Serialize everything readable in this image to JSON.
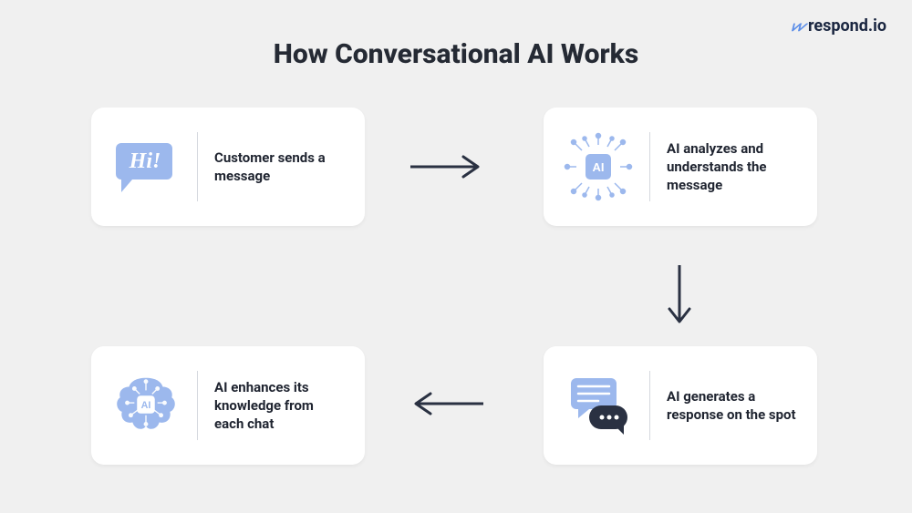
{
  "brand": {
    "name": "respond.io",
    "icon_label": "checkmark-wave"
  },
  "title": "How Conversational AI Works",
  "cards": {
    "step1": {
      "label": "Customer sends a message",
      "icon_name": "hi-speech-bubble-icon"
    },
    "step2": {
      "label": "AI analyzes and understands the message",
      "icon_name": "ai-chip-network-icon"
    },
    "step3": {
      "label": "AI generates a response on the spot",
      "icon_name": "chat-bubbles-icon"
    },
    "step4": {
      "label": "AI enhances its knowledge from each chat",
      "icon_name": "ai-brain-icon"
    }
  },
  "colors": {
    "accent_blue": "#9cb8ed",
    "dark_navy": "#2a3142",
    "text": "#1f2430"
  }
}
